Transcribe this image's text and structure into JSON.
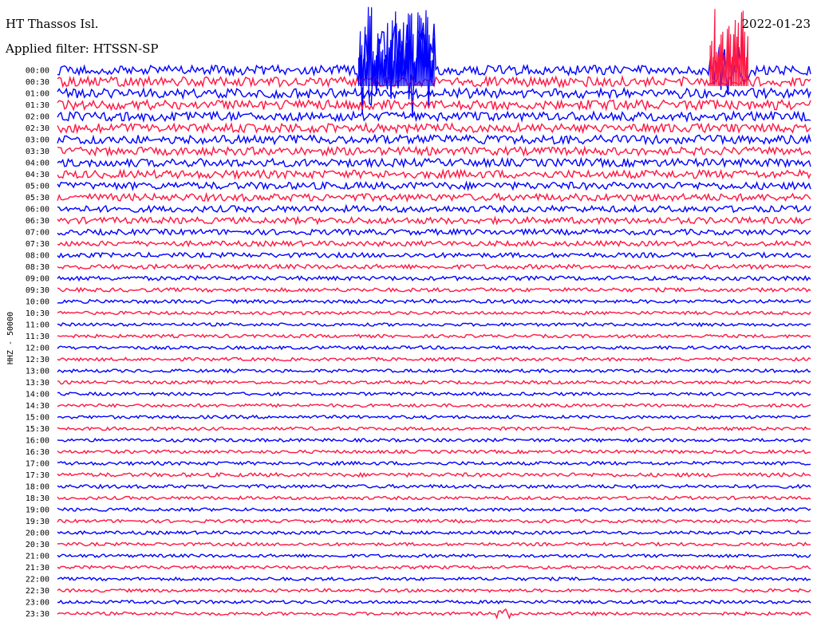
{
  "chart_data": {
    "type": "line",
    "title": "HT Thassos Isl.",
    "date": "2022-01-23",
    "subtitle": "Applied filter: HTSSN-SP",
    "ylabel": "HHZ - 50000",
    "row_labels": [
      "00:00",
      "00:30",
      "01:00",
      "01:30",
      "02:00",
      "02:30",
      "03:00",
      "03:30",
      "04:00",
      "04:30",
      "05:00",
      "05:30",
      "06:00",
      "06:30",
      "07:00",
      "07:30",
      "08:00",
      "08:30",
      "09:00",
      "09:30",
      "10:00",
      "10:30",
      "11:00",
      "11:30",
      "12:00",
      "12:30",
      "13:00",
      "13:30",
      "14:00",
      "14:30",
      "15:00",
      "15:30",
      "16:00",
      "16:30",
      "17:00",
      "17:30",
      "18:00",
      "18:30",
      "19:00",
      "19:30",
      "20:00",
      "20:30",
      "21:00",
      "21:30",
      "22:00",
      "22:30",
      "23:00",
      "23:30"
    ],
    "trace_colors": [
      "#0000ff",
      "#ff1744"
    ],
    "noise_level_by_row": [
      6,
      6,
      6,
      6,
      5.5,
      5.5,
      5.5,
      5,
      5,
      5,
      4.5,
      4.5,
      4,
      4,
      3.5,
      3.2,
      3,
      2.8,
      2.6,
      2.4,
      2.2,
      2,
      2,
      2,
      2,
      2,
      2,
      2,
      2,
      2,
      2,
      2,
      2,
      2,
      2.2,
      2.4,
      2.2,
      2,
      2,
      2,
      2,
      2,
      2,
      2,
      2,
      2,
      2,
      2
    ],
    "events": [
      {
        "row": 0,
        "minute_start": 12,
        "minute_end": 15,
        "amplitude": 10,
        "color": "#0000ff"
      },
      {
        "row": 0,
        "minute_start": 26,
        "minute_end": 27.5,
        "amplitude": 5,
        "color": "#ff1744"
      },
      {
        "row": 47,
        "minute_start": 17.5,
        "minute_end": 18.2,
        "amplitude": 3,
        "color": "#ff1744"
      }
    ],
    "grid": false,
    "legend": "none"
  }
}
